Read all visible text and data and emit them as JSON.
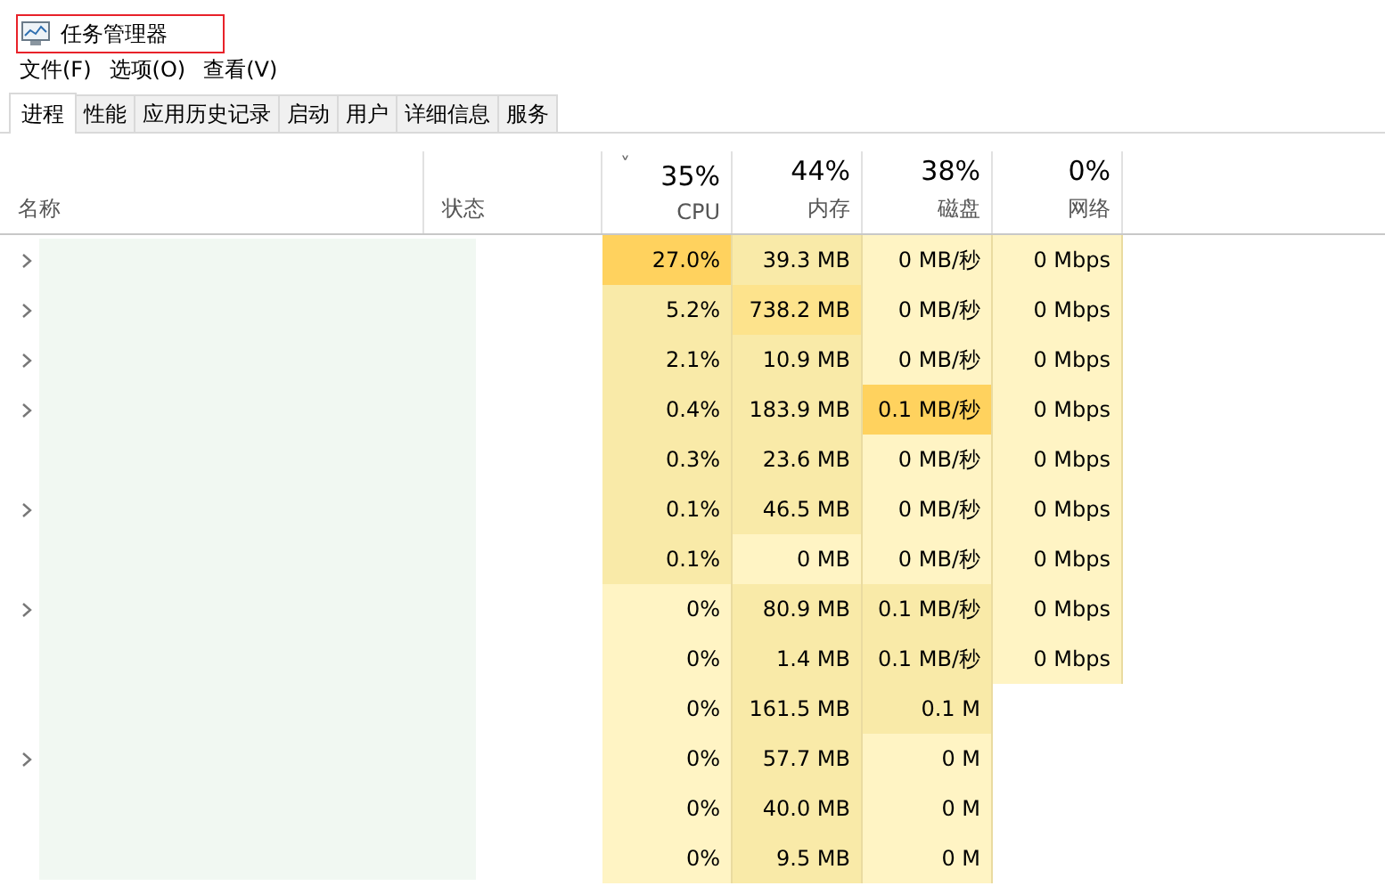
{
  "window": {
    "title": "任务管理器"
  },
  "menu": [
    "文件(F)",
    "选项(O)",
    "查看(V)"
  ],
  "tabs": [
    {
      "label": "进程",
      "selected": true
    },
    {
      "label": "性能",
      "selected": false
    },
    {
      "label": "应用历史记录",
      "selected": false
    },
    {
      "label": "启动",
      "selected": false
    },
    {
      "label": "用户",
      "selected": false
    },
    {
      "label": "详细信息",
      "selected": false
    },
    {
      "label": "服务",
      "selected": false
    }
  ],
  "table": {
    "sort_indicator": "˅",
    "columns": [
      {
        "label": "名称",
        "kind": "text",
        "sorted": false
      },
      {
        "label": "状态",
        "kind": "text",
        "sorted": false
      },
      {
        "label": "CPU",
        "total": "35%",
        "kind": "metric",
        "sorted": true
      },
      {
        "label": "内存",
        "total": "44%",
        "kind": "metric",
        "sorted": false
      },
      {
        "label": "磁盘",
        "total": "38%",
        "kind": "metric",
        "sorted": false
      },
      {
        "label": "网络",
        "total": "0%",
        "kind": "metric",
        "sorted": false
      }
    ],
    "rows": [
      {
        "expandable": true,
        "cells": [
          {
            "text": ""
          },
          {
            "text": ""
          },
          {
            "text": "27.0%",
            "color": "#ffd25e"
          },
          {
            "text": "39.3 MB",
            "color": "#f9eaa8"
          },
          {
            "text": "0 MB/秒",
            "color": "#fff4c4"
          },
          {
            "text": "0 Mbps",
            "color": "#fff4c4"
          }
        ]
      },
      {
        "expandable": true,
        "cells": [
          {
            "text": ""
          },
          {
            "text": ""
          },
          {
            "text": "5.2%",
            "color": "#f9eaa8"
          },
          {
            "text": "738.2 MB",
            "color": "#fde38c"
          },
          {
            "text": "0 MB/秒",
            "color": "#fff4c4"
          },
          {
            "text": "0 Mbps",
            "color": "#fff4c4"
          }
        ]
      },
      {
        "expandable": true,
        "cells": [
          {
            "text": ""
          },
          {
            "text": ""
          },
          {
            "text": "2.1%",
            "color": "#f9eaa8"
          },
          {
            "text": "10.9 MB",
            "color": "#f9eaa8"
          },
          {
            "text": "0 MB/秒",
            "color": "#fff4c4"
          },
          {
            "text": "0 Mbps",
            "color": "#fff4c4"
          }
        ]
      },
      {
        "expandable": true,
        "cells": [
          {
            "text": ""
          },
          {
            "text": ""
          },
          {
            "text": "0.4%",
            "color": "#f9eaa8"
          },
          {
            "text": "183.9 MB",
            "color": "#f9eaa8"
          },
          {
            "text": "0.1 MB/秒",
            "color": "#ffd25e"
          },
          {
            "text": "0 Mbps",
            "color": "#fff4c4"
          }
        ]
      },
      {
        "expandable": false,
        "cells": [
          {
            "text": ""
          },
          {
            "text": ""
          },
          {
            "text": "0.3%",
            "color": "#f9eaa8"
          },
          {
            "text": "23.6 MB",
            "color": "#f9eaa8"
          },
          {
            "text": "0 MB/秒",
            "color": "#fff4c4"
          },
          {
            "text": "0 Mbps",
            "color": "#fff4c4"
          }
        ]
      },
      {
        "expandable": true,
        "cells": [
          {
            "text": ""
          },
          {
            "text": ""
          },
          {
            "text": "0.1%",
            "color": "#f9eaa8"
          },
          {
            "text": "46.5 MB",
            "color": "#f9eaa8"
          },
          {
            "text": "0 MB/秒",
            "color": "#fff4c4"
          },
          {
            "text": "0 Mbps",
            "color": "#fff4c4"
          }
        ]
      },
      {
        "expandable": false,
        "cells": [
          {
            "text": ""
          },
          {
            "text": ""
          },
          {
            "text": "0.1%",
            "color": "#f9eaa8"
          },
          {
            "text": "0 MB",
            "color": "#fff4c4"
          },
          {
            "text": "0 MB/秒",
            "color": "#fff4c4"
          },
          {
            "text": "0 Mbps",
            "color": "#fff4c4"
          }
        ]
      },
      {
        "expandable": true,
        "cells": [
          {
            "text": ""
          },
          {
            "text": ""
          },
          {
            "text": "0%",
            "color": "#fff4c4"
          },
          {
            "text": "80.9 MB",
            "color": "#f9eaa8"
          },
          {
            "text": "0.1 MB/秒",
            "color": "#f9eaa8"
          },
          {
            "text": "0 Mbps",
            "color": "#fff4c4"
          }
        ]
      },
      {
        "expandable": false,
        "cells": [
          {
            "text": ""
          },
          {
            "text": ""
          },
          {
            "text": "0%",
            "color": "#fff4c4"
          },
          {
            "text": "1.4 MB",
            "color": "#f9eaa8"
          },
          {
            "text": "0.1 MB/秒",
            "color": "#f9eaa8"
          },
          {
            "text": "0 Mbps",
            "color": "#fff4c4"
          }
        ]
      },
      {
        "expandable": false,
        "cells": [
          {
            "text": ""
          },
          {
            "text": ""
          },
          {
            "text": "0%",
            "color": "#fff4c4"
          },
          {
            "text": "161.5 MB",
            "color": "#f9eaa8"
          },
          {
            "text": "0.1 M",
            "color": "#f9eaa8"
          }
        ]
      },
      {
        "expandable": true,
        "cells": [
          {
            "text": ""
          },
          {
            "text": ""
          },
          {
            "text": "0%",
            "color": "#fff4c4"
          },
          {
            "text": "57.7 MB",
            "color": "#f9eaa8"
          },
          {
            "text": "0 M",
            "color": "#fff4c4"
          }
        ]
      },
      {
        "expandable": false,
        "cells": [
          {
            "text": ""
          },
          {
            "text": ""
          },
          {
            "text": "0%",
            "color": "#fff4c4"
          },
          {
            "text": "40.0 MB",
            "color": "#f9eaa8"
          },
          {
            "text": "0 M",
            "color": "#fff4c4"
          }
        ]
      },
      {
        "expandable": false,
        "cells": [
          {
            "text": ""
          },
          {
            "text": ""
          },
          {
            "text": "0%",
            "color": "#fff4c4"
          },
          {
            "text": "9.5 MB",
            "color": "#f9eaa8"
          },
          {
            "text": "0 M",
            "color": "#fff4c4"
          }
        ]
      }
    ]
  }
}
